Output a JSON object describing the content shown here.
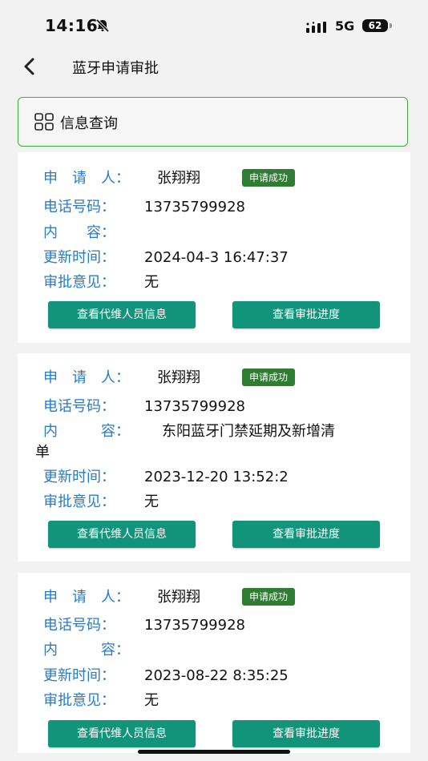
{
  "status": {
    "time": "14:16",
    "network": "5G",
    "battery": "62"
  },
  "header": {
    "title": "蓝牙申请审批"
  },
  "query": {
    "label": "信息查询"
  },
  "labels": {
    "applicant": "申　请　人：",
    "phone": "电话号码：",
    "content_short": "内　　容：",
    "content_long": "内　　　容：",
    "updated": "更新时间：",
    "opinion": "审批意见："
  },
  "cards": [
    {
      "applicant": "张翔翔",
      "status": "申请成功",
      "phone": "13735799928",
      "content": "",
      "updated": "2024-04-3 16:47:37",
      "opinion": "无",
      "btn_info": "查看代维人员信息",
      "btn_progress": "查看审批进度"
    },
    {
      "applicant": "张翔翔",
      "status": "申请成功",
      "phone": "13735799928",
      "content": "东阳蓝牙门禁延期及新增清",
      "content_cont": "单",
      "updated": "2023-12-20 13:52:2",
      "opinion": "无",
      "btn_info": "查看代维人员信息",
      "btn_progress": "查看审批进度"
    },
    {
      "applicant": "张翔翔",
      "status": "申请成功",
      "phone": "13735799928",
      "content": "",
      "updated": "2023-08-22 8:35:25",
      "opinion": "无",
      "btn_info": "查看代维人员信息",
      "btn_progress": "查看审批进度"
    }
  ]
}
